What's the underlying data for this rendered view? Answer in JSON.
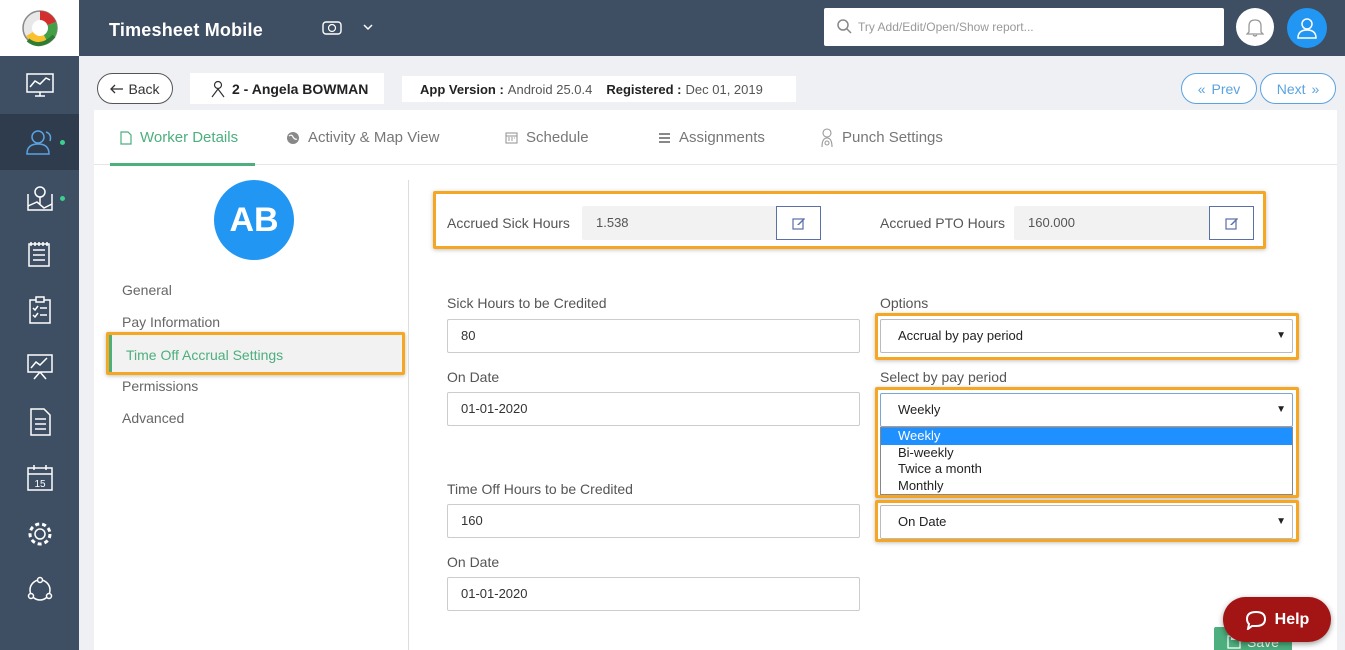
{
  "header": {
    "app_title": "Timesheet Mobile",
    "search_placeholder": "Try Add/Edit/Open/Show report..."
  },
  "toolbar": {
    "back_label": "Back",
    "worker_name": "2 - Angela BOWMAN",
    "app_version_label": "App Version :",
    "app_version_value": "Android 25.0.4",
    "registered_label": "Registered :",
    "registered_value": "Dec 01, 2019",
    "prev_label": "Prev",
    "next_label": "Next"
  },
  "tabs": [
    {
      "label": "Worker Details"
    },
    {
      "label": "Activity & Map View"
    },
    {
      "label": "Schedule"
    },
    {
      "label": "Assignments"
    },
    {
      "label": "Punch Settings"
    }
  ],
  "profile": {
    "initials": "AB",
    "menu": [
      {
        "label": "General"
      },
      {
        "label": "Pay Information"
      },
      {
        "label": "Time Off Accrual Settings"
      },
      {
        "label": "Permissions"
      },
      {
        "label": "Advanced"
      }
    ]
  },
  "accrued": {
    "sick_label": "Accrued Sick Hours",
    "sick_value": "1.538",
    "pto_label": "Accrued PTO Hours",
    "pto_value": "160.000"
  },
  "form": {
    "sick_credit_label": "Sick Hours to be Credited",
    "sick_credit_value": "80",
    "on_date_label": "On Date",
    "sick_on_date_value": "01-01-2020",
    "timeoff_credit_label": "Time Off Hours to be Credited",
    "timeoff_credit_value": "160",
    "timeoff_on_date_value": "01-01-2020",
    "options_label": "Options",
    "options_value": "Accrual by pay period",
    "pay_period_label": "Select by pay period",
    "pay_period_value": "Weekly",
    "pay_period_options": [
      "Weekly",
      "Bi-weekly",
      "Twice a month",
      "Monthly"
    ],
    "third_select_value": "On Date"
  },
  "actions": {
    "save_label": "Save",
    "help_label": "Help"
  },
  "colors": {
    "sidebar": "#3e4e63",
    "accent_green": "#4caf7d",
    "accent_blue": "#2196f3",
    "highlight": "#f5a623",
    "help_red": "#a31515"
  }
}
